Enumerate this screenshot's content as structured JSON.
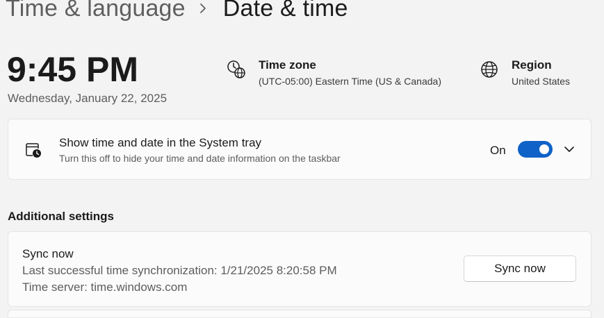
{
  "breadcrumb": {
    "parent": "Time & language",
    "current": "Date & time"
  },
  "clock": {
    "time": "9:45 PM",
    "date": "Wednesday, January 22, 2025"
  },
  "timezone": {
    "title": "Time zone",
    "value": "(UTC-05:00) Eastern Time (US & Canada)",
    "icon": "clock-globe-icon"
  },
  "region": {
    "title": "Region",
    "value": "United States",
    "icon": "globe-icon"
  },
  "tray": {
    "title": "Show time and date in the System tray",
    "description": "Turn this off to hide your time and date information on the taskbar",
    "toggle_label": "On",
    "toggle_on": true,
    "icon": "calendar-clock-icon"
  },
  "additional": {
    "title": "Additional settings"
  },
  "sync": {
    "title": "Sync now",
    "last_sync": "Last successful time synchronization: 1/21/2025 8:20:58 PM",
    "server": "Time server: time.windows.com",
    "button_label": "Sync now"
  },
  "colors": {
    "accent": "#0f62c8",
    "background": "#f3f3f3",
    "card": "#fbfbfb"
  }
}
